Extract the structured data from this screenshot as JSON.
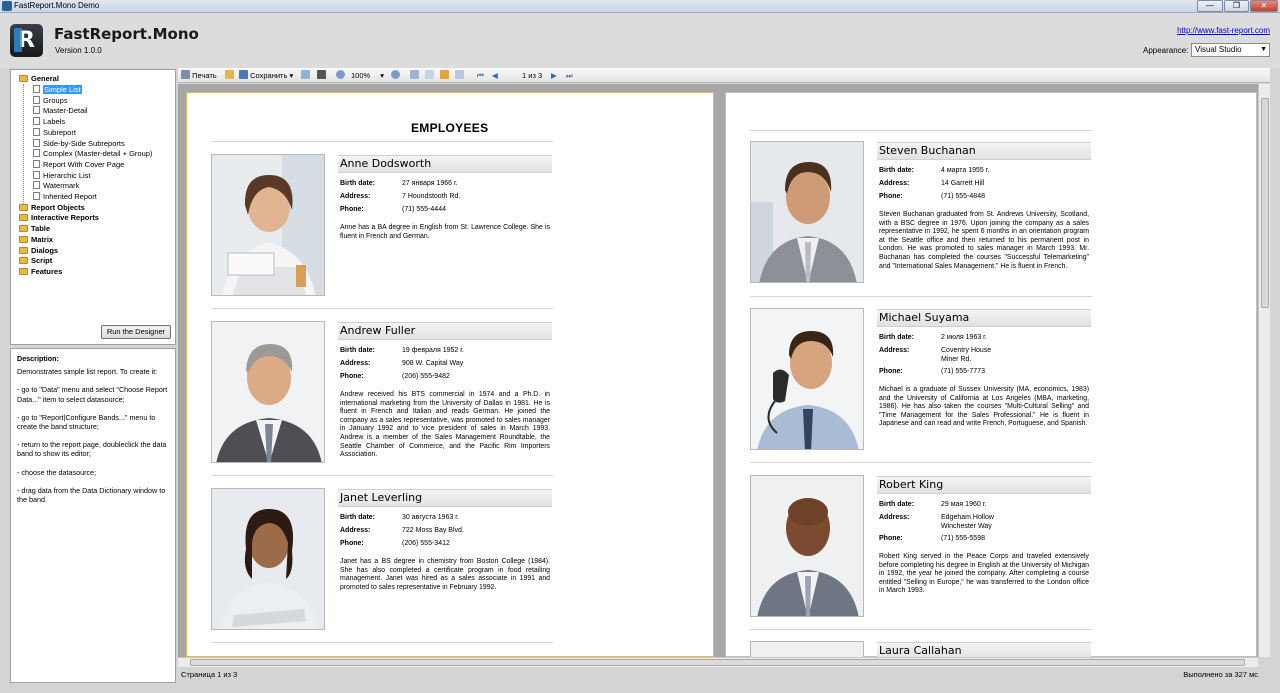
{
  "window": {
    "title": "FastReport.Mono Demo"
  },
  "header": {
    "app_name": "FastReport.Mono",
    "version": "Version 1.0.0",
    "site_link": "http://www.fast-report.com",
    "appearance_label": "Appearance:",
    "appearance_value": "Visual Studio"
  },
  "tree": {
    "general": "General",
    "items": [
      "Simple List",
      "Groups",
      "Master-Detail",
      "Labels",
      "Subreport",
      "Side-by-Side Subreports",
      "Complex (Master-detail + Group)",
      "Report With Cover Page",
      "Hierarchic List",
      "Watermark",
      "Inherited Report"
    ],
    "categories": [
      "Report Objects",
      "Interactive Reports",
      "Table",
      "Matrix",
      "Dialogs",
      "Script",
      "Features"
    ]
  },
  "run_designer": "Run the Designer",
  "description": {
    "heading": "Description:",
    "paragraphs": [
      "Demonstrates simple list report. To create it:",
      "- go to \"Data\" menu and select \"Choose Report Data...\" item to select datasource;",
      "- go to \"Report|Configure Bands...\" menu to create the band structure;",
      "- return to the report page, doubleclick the data band to show its editor;",
      "- choose the datasource;",
      "- drag data from the Data Dictionary window to the band."
    ]
  },
  "toolbar": {
    "print": "Печать",
    "save": "Сохранить",
    "zoom": "100%",
    "page_nav": "1 из 3"
  },
  "report": {
    "title": "EMPLOYEES",
    "labels": {
      "birth": "Birth date:",
      "address": "Address:",
      "phone": "Phone:"
    },
    "employees": [
      {
        "name": "Anne Dodsworth",
        "birth": "27 января 1966 г.",
        "address": [
          "7 Houndstooth Rd."
        ],
        "phone": "(71) 555-4444",
        "bio": "Anne has a BA degree in English from St. Lawrence College. She is fluent in French and German."
      },
      {
        "name": "Andrew Fuller",
        "birth": "19 февраля 1952 г.",
        "address": [
          "908 W. Capital Way"
        ],
        "phone": "(206) 555-9482",
        "bio": "Andrew received his BTS commercial in 1974 and a Ph.D. in international marketing from the University of Dallas in 1981. He is fluent in French and Italian and reads German. He joined the company as a sales representative, was promoted to sales manager in January 1992 and to vice president of sales in March 1993. Andrew is a member of the Sales Management Roundtable, the Seattle Chamber of Commerce, and the Pacific Rim Importers Association."
      },
      {
        "name": "Janet Leverling",
        "birth": "30 августа 1963 г.",
        "address": [
          "722 Moss Bay Blvd."
        ],
        "phone": "(206) 555-3412",
        "bio": "Janet has a BS degree in chemistry from Boston College (1984). She has also completed a certificate program in food retailing management. Janet was hired as a sales associate in 1991 and promoted to sales representative in February 1992."
      },
      {
        "name": "Steven Buchanan",
        "birth": "4 марта 1955 г.",
        "address": [
          "14 Garrett Hill"
        ],
        "phone": "(71) 555-4848",
        "bio": "Steven Buchanan graduated from St. Andrews University, Scotland, with a BSC degree in 1976. Upon joining the company as a sales representative in 1992, he spent 6 months in an orientation program at the Seattle office and then returned to his permanent post in London. He was promoted to sales manager in March 1993. Mr. Buchanan has completed the courses \"Successful Telemarketing\" and \"International Sales Management.\" He is fluent in French."
      },
      {
        "name": "Michael Suyama",
        "birth": "2 июля 1963 г.",
        "address": [
          "Coventry House",
          "Miner Rd."
        ],
        "phone": "(71) 555-7773",
        "bio": "Michael is a graduate of Sussex University (MA, economics, 1983) and the University of California at Los Angeles (MBA, marketing, 1986). He has also taken the courses \"Multi-Cultural Selling\" and \"Time Management for the Sales Professional.\" He is fluent in Japanese and can read and write French, Portuguese, and Spanish."
      },
      {
        "name": "Robert King",
        "birth": "29 мая 1960 г.",
        "address": [
          "Edgeham Hollow",
          "Winchester Way"
        ],
        "phone": "(71) 555-5598",
        "bio": "Robert King served in the Peace Corps and traveled extensively before completing his degree in English at the University of Michigan in 1992, the year he joined the company. After completing a course entitled \"Selling in Europe,\" he was transferred to the London office in March 1993."
      },
      {
        "name": "Laura Callahan"
      }
    ]
  },
  "status": {
    "left": "Страница 1 из 3",
    "right": "Выполнено за 327 мс"
  }
}
